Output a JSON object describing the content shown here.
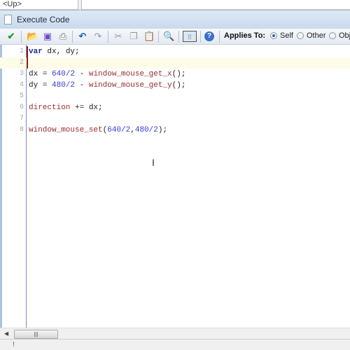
{
  "background_window": {
    "up_label": "<Up>"
  },
  "window": {
    "title": "Execute Code"
  },
  "toolbar": {
    "buttons": [
      "check-icon",
      "open-icon",
      "save-icon",
      "print-icon",
      "undo-icon",
      "redo-icon",
      "cut-icon",
      "copy-icon",
      "paste-icon",
      "find-icon",
      "snippets-icon",
      "help-icon"
    ],
    "applies_to_label": "Applies To:",
    "options": [
      {
        "label": "Self",
        "selected": true
      },
      {
        "label": "Other",
        "selected": false
      },
      {
        "label": "Obj",
        "selected": false
      }
    ]
  },
  "editor": {
    "current_line": 2,
    "lines": [
      {
        "n": "1",
        "tokens": [
          [
            "kw",
            "var"
          ],
          [
            "plain",
            " dx, dy;"
          ]
        ]
      },
      {
        "n": "2",
        "tokens": []
      },
      {
        "n": "3",
        "tokens": [
          [
            "plain",
            "dx = "
          ],
          [
            "num",
            "640/2"
          ],
          [
            "plain",
            " - "
          ],
          [
            "fn",
            "window_mouse_get_x"
          ],
          [
            "plain",
            "();"
          ]
        ]
      },
      {
        "n": "4",
        "tokens": [
          [
            "plain",
            "dy = "
          ],
          [
            "num",
            "480/2"
          ],
          [
            "plain",
            " - "
          ],
          [
            "fn",
            "window_mouse_get_y"
          ],
          [
            "plain",
            "();"
          ]
        ]
      },
      {
        "n": "5",
        "tokens": []
      },
      {
        "n": "6",
        "tokens": [
          [
            "fn",
            "direction"
          ],
          [
            "plain",
            " += dx;"
          ]
        ]
      },
      {
        "n": "7",
        "tokens": []
      },
      {
        "n": "8",
        "tokens": [
          [
            "fn",
            "window_mouse_set"
          ],
          [
            "plain",
            "("
          ],
          [
            "num",
            "640/2"
          ],
          [
            "plain",
            ","
          ],
          [
            "num",
            "480/2"
          ],
          [
            "plain",
            ");"
          ]
        ]
      }
    ]
  },
  "status": {
    "text": "!"
  }
}
